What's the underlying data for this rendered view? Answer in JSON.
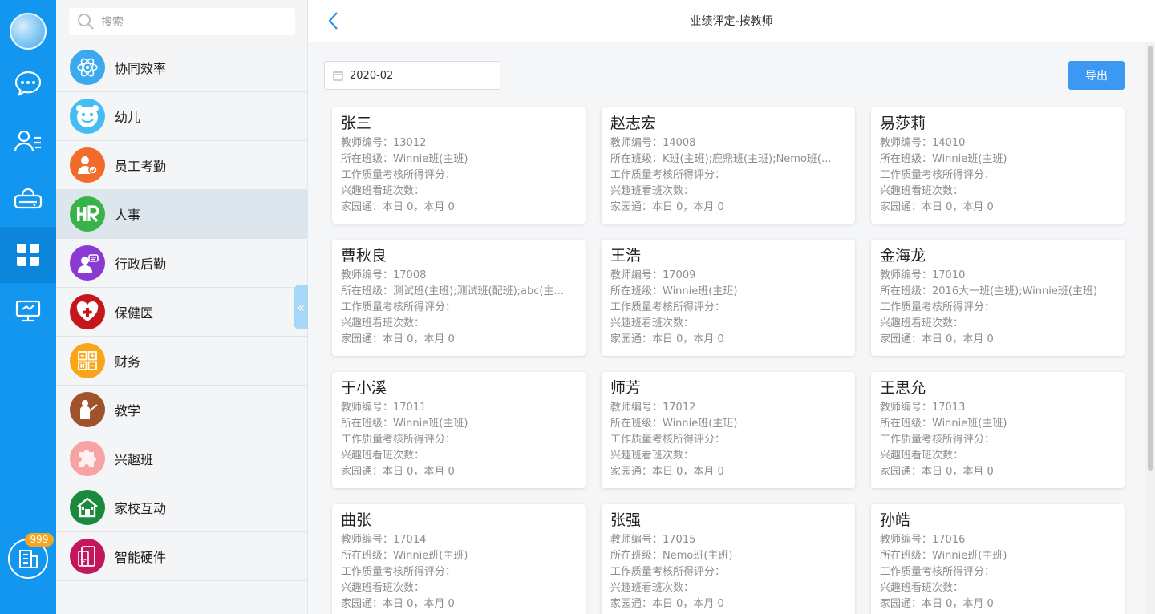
{
  "rail": {
    "badge": "999",
    "icons": [
      "chat-icon",
      "contacts-icon",
      "cloud-drive-icon",
      "apps-grid-icon",
      "monitor-icon"
    ]
  },
  "search": {
    "placeholder": "搜索"
  },
  "menu": {
    "items": [
      {
        "label": "协同效率",
        "icon": "atom-icon",
        "color": "#3aa9f0"
      },
      {
        "label": "幼儿",
        "icon": "smiley-icon",
        "color": "#45bdf2"
      },
      {
        "label": "员工考勤",
        "icon": "attendance-icon",
        "color": "#f16b2b"
      },
      {
        "label": "人事",
        "icon": "hr-icon",
        "color": "#37b34a"
      },
      {
        "label": "行政后勤",
        "icon": "admin-icon",
        "color": "#8a3ad0"
      },
      {
        "label": "保健医",
        "icon": "health-icon",
        "color": "#c4161c"
      },
      {
        "label": "财务",
        "icon": "finance-icon",
        "color": "#f9a51a"
      },
      {
        "label": "教学",
        "icon": "teaching-icon",
        "color": "#a0522d"
      },
      {
        "label": "兴趣班",
        "icon": "puzzle-icon",
        "color": "#f7a3a3"
      },
      {
        "label": "家校互动",
        "icon": "home-school-icon",
        "color": "#1a8a3c"
      },
      {
        "label": "智能硬件",
        "icon": "hardware-icon",
        "color": "#c2185b"
      }
    ]
  },
  "header": {
    "title": "业绩评定-按教师"
  },
  "toolbar": {
    "date": "2020-02",
    "export_label": "导出"
  },
  "teachers": [
    {
      "name": "张三",
      "id": "教师编号：13012",
      "class": "所在班级：Winnie班(主班)",
      "quality": "工作质量考核所得评分：",
      "interest": "兴趣班看班次数：",
      "home": "家园通：本日 0，本月 0"
    },
    {
      "name": "赵志宏",
      "id": "教师编号：14008",
      "class": "所在班级：K班(主班);鹿鼎班(主班);Nemo班(...",
      "quality": "工作质量考核所得评分：",
      "interest": "兴趣班看班次数：",
      "home": "家园通：本日 0，本月 0"
    },
    {
      "name": "易莎莉",
      "id": "教师编号：14010",
      "class": "所在班级：Winnie班(主班)",
      "quality": "工作质量考核所得评分：",
      "interest": "兴趣班看班次数：",
      "home": "家园通：本日 0，本月 0"
    },
    {
      "name": "曹秋良",
      "id": "教师编号：17008",
      "class": "所在班级：测试班(主班);测试班(配班);abc(主...",
      "quality": "工作质量考核所得评分：",
      "interest": "兴趣班看班次数：",
      "home": "家园通：本日 0，本月 0"
    },
    {
      "name": "王浩",
      "id": "教师编号：17009",
      "class": "所在班级：Winnie班(主班)",
      "quality": "工作质量考核所得评分：",
      "interest": "兴趣班看班次数：",
      "home": "家园通：本日 0，本月 0"
    },
    {
      "name": "金海龙",
      "id": "教师编号：17010",
      "class": "所在班级：2016大一班(主班);Winnie班(主班)",
      "quality": "工作质量考核所得评分：",
      "interest": "兴趣班看班次数：",
      "home": "家园通：本日 0，本月 0"
    },
    {
      "name": "于小溪",
      "id": "教师编号：17011",
      "class": "所在班级：Winnie班(主班)",
      "quality": "工作质量考核所得评分：",
      "interest": "兴趣班看班次数：",
      "home": "家园通：本日 0，本月 0"
    },
    {
      "name": "师芳",
      "id": "教师编号：17012",
      "class": "所在班级：Winnie班(主班)",
      "quality": "工作质量考核所得评分：",
      "interest": "兴趣班看班次数：",
      "home": "家园通：本日 0，本月 0"
    },
    {
      "name": "王思允",
      "id": "教师编号：17013",
      "class": "所在班级：Winnie班(主班)",
      "quality": "工作质量考核所得评分：",
      "interest": "兴趣班看班次数：",
      "home": "家园通：本日 0，本月 0"
    },
    {
      "name": "曲张",
      "id": "教师编号：17014",
      "class": "所在班级：Winnie班(主班)",
      "quality": "工作质量考核所得评分：",
      "interest": "兴趣班看班次数：",
      "home": "家园通：本日 0，本月 0"
    },
    {
      "name": "张强",
      "id": "教师编号：17015",
      "class": "所在班级：Nemo班(主班)",
      "quality": "工作质量考核所得评分：",
      "interest": "兴趣班看班次数：",
      "home": "家园通：本日 0，本月 0"
    },
    {
      "name": "孙皓",
      "id": "教师编号：17016",
      "class": "所在班级：Winnie班(主班)",
      "quality": "工作质量考核所得评分：",
      "interest": "兴趣班看班次数：",
      "home": "家园通：本日 0，本月 0"
    }
  ]
}
